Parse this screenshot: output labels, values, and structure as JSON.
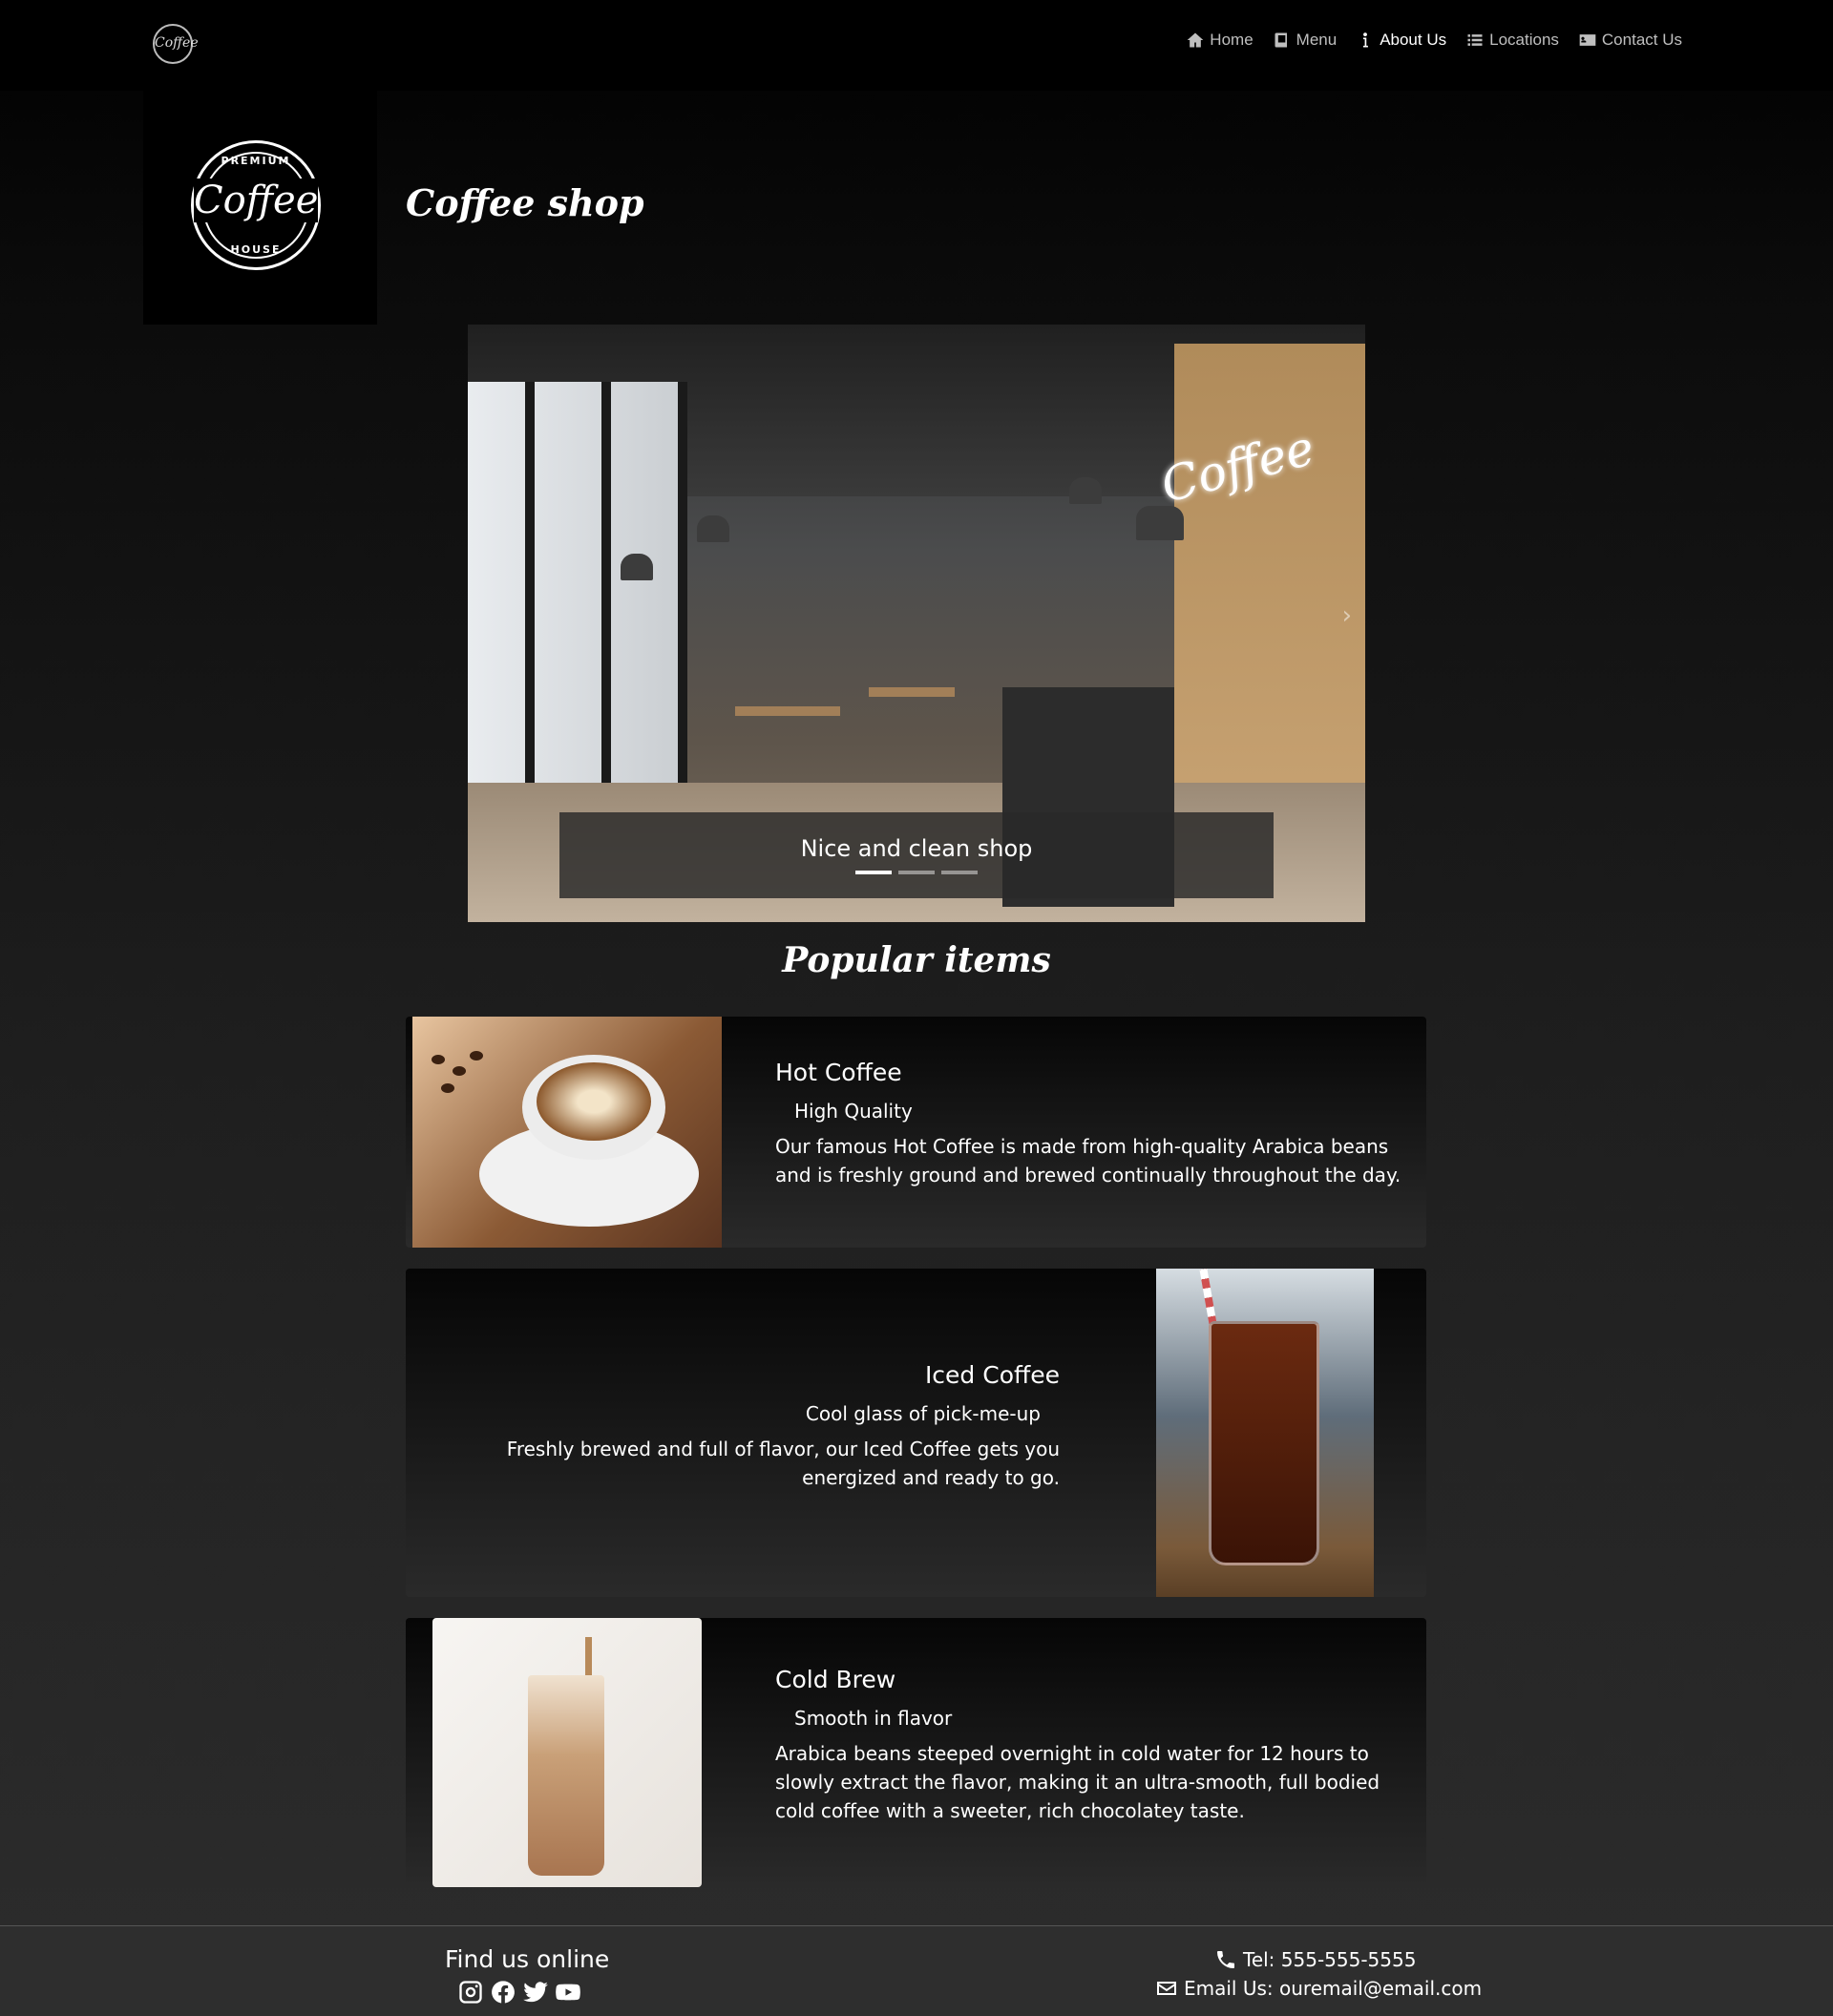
{
  "nav": {
    "logo_text": "Coffee",
    "links": [
      {
        "label": "Home",
        "icon": "home-icon"
      },
      {
        "label": "Menu",
        "icon": "book-icon"
      },
      {
        "label": "About Us",
        "icon": "info-icon"
      },
      {
        "label": "Locations",
        "icon": "list-icon"
      },
      {
        "label": "Contact Us",
        "icon": "address-card-icon"
      }
    ],
    "active": "About Us"
  },
  "brand": {
    "logo_top": "PREMIUM",
    "logo_main": "Coffee",
    "logo_bottom": "HOUSE"
  },
  "header": {
    "title": "Coffee shop"
  },
  "carousel": {
    "image_sign": "Coffee",
    "caption": "Nice and clean shop",
    "slide_count": 3,
    "active_slide": 1,
    "next_icon": "chevron-right-icon"
  },
  "section": {
    "title": "Popular items"
  },
  "items": [
    {
      "title": "Hot Coffee",
      "subtitle": "High Quality",
      "description": "Our famous Hot Coffee is made from high-quality Arabica beans and is freshly ground and brewed continually throughout the day."
    },
    {
      "title": "Iced Coffee",
      "subtitle": "Cool glass of pick-me-up",
      "description": "Freshly brewed and full of flavor, our Iced Coffee gets you energized and ready to go."
    },
    {
      "title": "Cold Brew",
      "subtitle": "Smooth in flavor",
      "description": "Arabica beans steeped overnight in cold water for 12 hours to slowly extract the flavor, making it an ultra-smooth, full bodied cold coffee with a sweeter, rich chocolatey taste."
    }
  ],
  "footer": {
    "find_label": "Find us online",
    "socials": [
      "instagram-icon",
      "facebook-icon",
      "twitter-icon",
      "youtube-icon"
    ],
    "phone": "Tel: 555-555-5555",
    "email": "Email Us: ouremail@email.com"
  },
  "colors": {
    "background_top": "#000000",
    "background_bottom": "#2b2b2b",
    "text": "#ffffff",
    "nav_text": "#bfbfbf"
  }
}
